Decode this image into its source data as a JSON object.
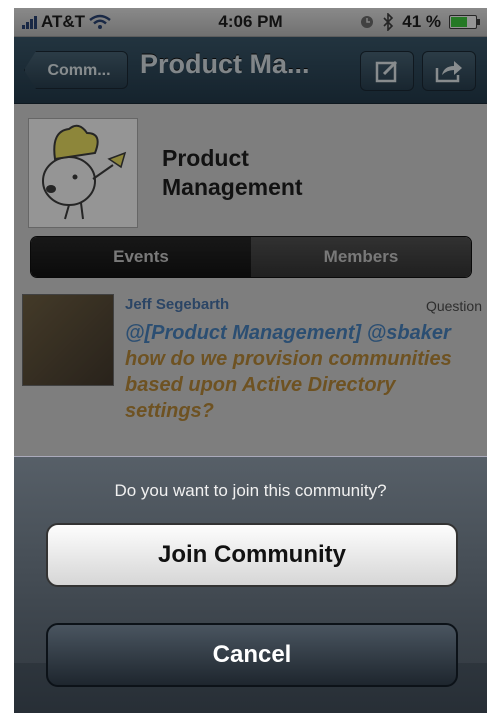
{
  "status": {
    "carrier": "AT&T",
    "time": "4:06 PM",
    "battery": "41 %"
  },
  "nav": {
    "back_label": "Comm...",
    "title": "Product Ma..."
  },
  "community": {
    "name_line1": "Product",
    "name_line2": "Management"
  },
  "tabs": [
    {
      "label": "Events"
    },
    {
      "label": "Members"
    }
  ],
  "post": {
    "author": "Jeff Segebarth",
    "type": "Question",
    "mention": "@[Product Management] @sbaker",
    "body": "how do we provision communities based upon Active Directory settings?"
  },
  "sheet": {
    "prompt": "Do you want to join this community?",
    "join_label": "Join Community",
    "cancel_label": "Cancel"
  }
}
